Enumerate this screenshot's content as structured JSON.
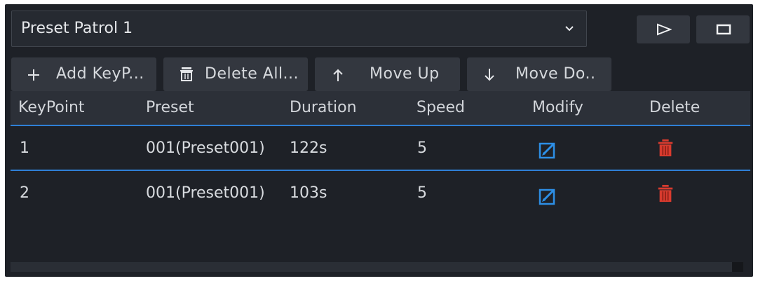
{
  "patrol_select": {
    "value": "Preset Patrol 1"
  },
  "controls": {
    "play_icon": "play-outline-icon",
    "stop_icon": "stop-icon"
  },
  "toolbar": {
    "add_label": "Add KeyP...",
    "delete_all_label": "Delete All...",
    "move_up_label": "Move Up",
    "move_down_label": "Move Do.."
  },
  "table": {
    "columns": [
      "KeyPoint",
      "Preset",
      "Duration",
      "Speed",
      "Modify",
      "Delete"
    ],
    "rows": [
      {
        "keypoint": "1",
        "preset": "001(Preset001)",
        "duration": "122s",
        "speed": "5"
      },
      {
        "keypoint": "2",
        "preset": "001(Preset001)",
        "duration": "103s",
        "speed": "5"
      }
    ]
  },
  "colors": {
    "background": "#1e2127",
    "accent_blue": "#2f7fd6",
    "modify_icon": "#2d8fe6",
    "delete_icon": "#d83b2e"
  }
}
